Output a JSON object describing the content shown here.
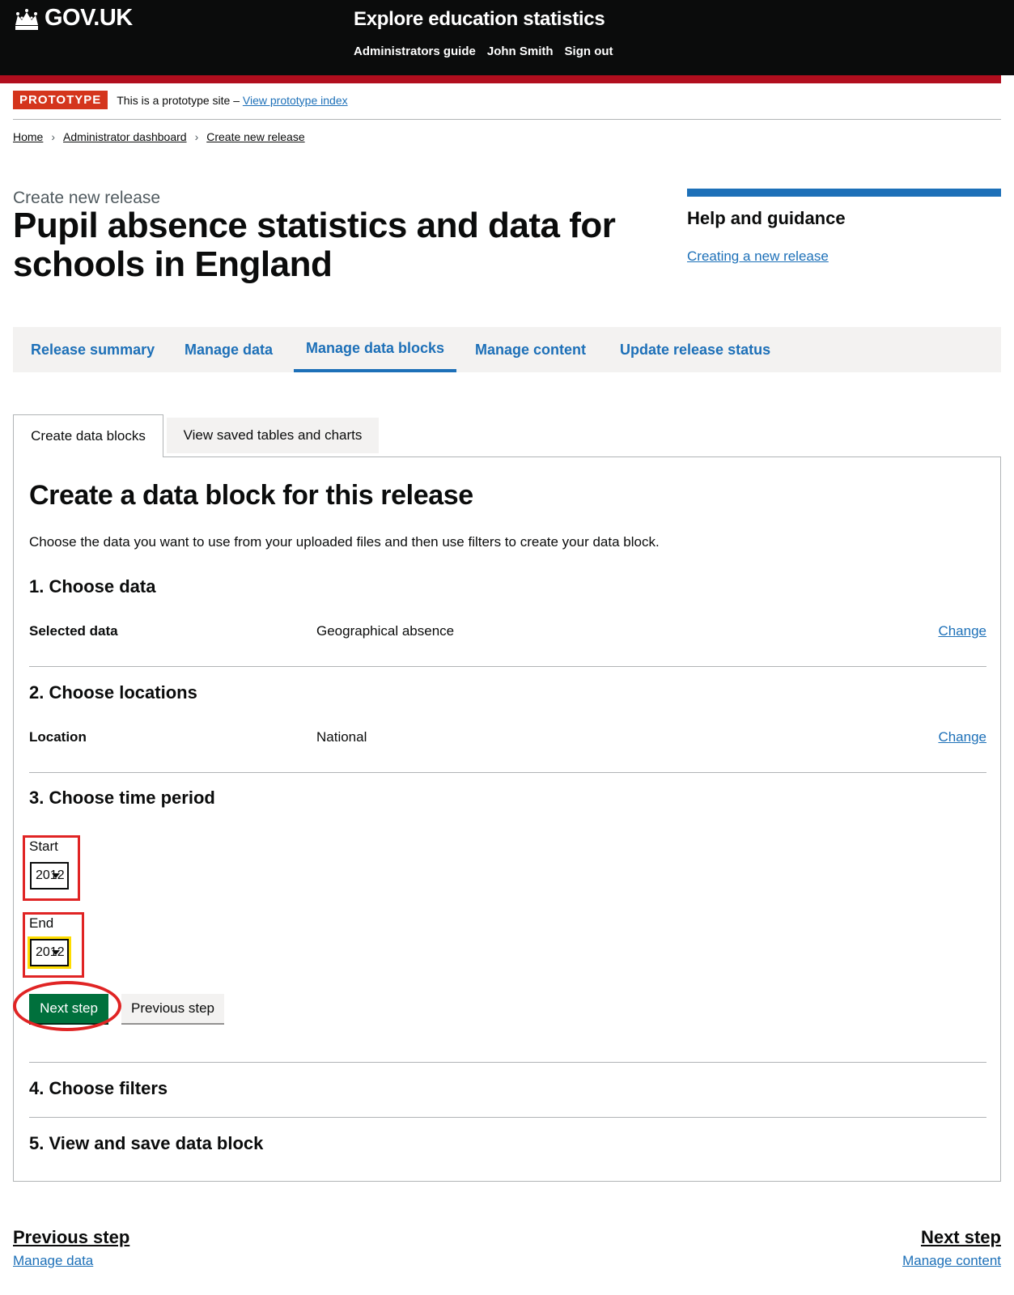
{
  "header": {
    "logo_text": "GOV.UK",
    "service_name": "Explore education statistics",
    "nav": [
      "Administrators guide",
      "John Smith",
      "Sign out"
    ]
  },
  "phase_banner": {
    "tag": "PROTOTYPE",
    "text": "This is a prototype site –",
    "link": "View prototype index"
  },
  "breadcrumbs": [
    "Home",
    "Administrator dashboard",
    "Create new release"
  ],
  "page": {
    "caption": "Create new release",
    "title": "Pupil absence statistics and data for schools in England"
  },
  "help": {
    "heading": "Help and guidance",
    "link": "Creating a new release"
  },
  "nav_tabs": [
    {
      "label": "Release summary",
      "active": false
    },
    {
      "label": "Manage data",
      "active": false
    },
    {
      "label": "Manage data blocks",
      "active": true
    },
    {
      "label": "Manage content",
      "active": false
    },
    {
      "label": "Update release status",
      "active": false
    }
  ],
  "tabs": [
    "Create data blocks",
    "View saved tables and charts"
  ],
  "panel": {
    "title": "Create a data block for this release",
    "intro": "Choose the data you want to use from your uploaded files and then use filters to create your data block.",
    "steps": {
      "s1": {
        "heading": "1. Choose data",
        "key": "Selected data",
        "value": "Geographical absence",
        "change": "Change"
      },
      "s2": {
        "heading": "2. Choose locations",
        "key": "Location",
        "value": "National",
        "change": "Change"
      },
      "s3": {
        "heading": "3. Choose time period",
        "start_label": "Start",
        "start_value": "2012",
        "end_label": "End",
        "end_value": "2012",
        "next_button": "Next step",
        "prev_button": "Previous step"
      },
      "s4": {
        "heading": "4. Choose filters"
      },
      "s5": {
        "heading": "5. View and save data block"
      }
    }
  },
  "pagination": {
    "prev_label": "Previous step",
    "prev_sub": "Manage data",
    "next_label": "Next step",
    "next_sub": "Manage content"
  },
  "colors": {
    "header_bg": "#0b0c0c",
    "red_bar": "#b10e1e",
    "link": "#1d70b8",
    "button_green": "#00703c",
    "annotation_red": "#e02424",
    "focus_yellow": "#ffdd00"
  },
  "icons": [
    "crown-icon",
    "chevron-right-icon",
    "dropdown-arrow-icon"
  ]
}
